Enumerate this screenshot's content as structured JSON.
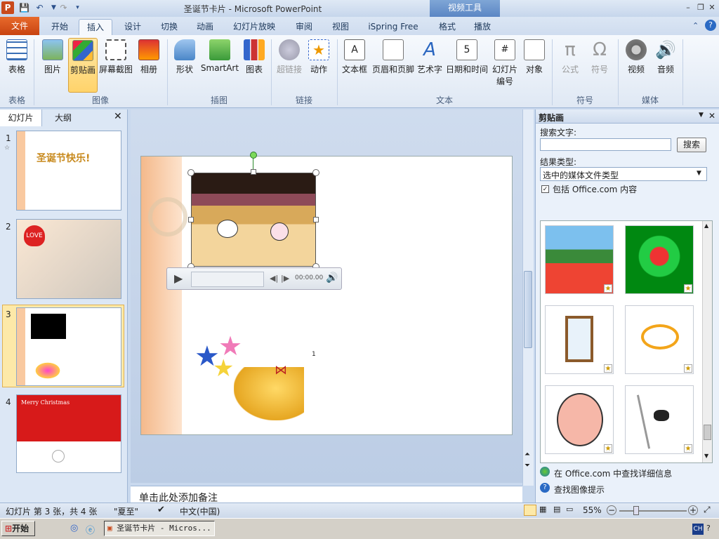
{
  "title": "圣诞节卡片 - Microsoft PowerPoint",
  "contextual_tab": "视频工具",
  "tabs": {
    "file": "文件",
    "items": [
      {
        "label": "开始"
      },
      {
        "label": "插入"
      },
      {
        "label": "设计"
      },
      {
        "label": "切换"
      },
      {
        "label": "动画"
      },
      {
        "label": "幻灯片放映"
      },
      {
        "label": "审阅"
      },
      {
        "label": "视图"
      },
      {
        "label": "iSpring Free"
      },
      {
        "label": "格式"
      },
      {
        "label": "播放"
      }
    ],
    "active": "插入"
  },
  "ribbon": {
    "buttons": [
      {
        "label": "表格"
      },
      {
        "label": "图片"
      },
      {
        "label": "剪贴画"
      },
      {
        "label": "屏幕截图"
      },
      {
        "label": "相册"
      },
      {
        "label": "形状"
      },
      {
        "label": "SmartArt"
      },
      {
        "label": "图表"
      },
      {
        "label": "超链接"
      },
      {
        "label": "动作"
      },
      {
        "label": "文本框"
      },
      {
        "label": "页眉和页脚"
      },
      {
        "label": "艺术字"
      },
      {
        "label": "日期和时间"
      },
      {
        "label": "幻灯片"
      },
      {
        "label": "编号"
      },
      {
        "label": "对象"
      },
      {
        "label": "公式"
      },
      {
        "label": "符号"
      },
      {
        "label": "视频"
      },
      {
        "label": "音频"
      }
    ],
    "groups": [
      {
        "label": "表格"
      },
      {
        "label": "图像"
      },
      {
        "label": "插图"
      },
      {
        "label": "链接"
      },
      {
        "label": "文本"
      },
      {
        "label": "符号"
      },
      {
        "label": "媒体"
      }
    ]
  },
  "left_pane": {
    "tabs": [
      "幻灯片",
      "大纲"
    ],
    "slides": [
      {
        "num": "1",
        "text": "圣诞节快乐!"
      },
      {
        "num": "2",
        "text": "LOVE"
      },
      {
        "num": "3",
        "text": ""
      },
      {
        "num": "4",
        "text": "Merry Christmas"
      }
    ]
  },
  "video": {
    "time": "00:00.00"
  },
  "slide_page_marker": "1",
  "notes_placeholder": "单击此处添加备注",
  "clipart": {
    "title": "剪贴画",
    "search_label": "搜索文字:",
    "search_value": "",
    "search_button": "搜索",
    "result_type_label": "结果类型:",
    "result_type_value": "选中的媒体文件类型",
    "include_office": "包括 Office.com 内容",
    "include_checked": true,
    "items": [
      {
        "icon": "tulips-windmill-clip"
      },
      {
        "icon": "red-flowers-clip"
      },
      {
        "icon": "window-clip"
      },
      {
        "icon": "tiger-hoop-clip"
      },
      {
        "icon": "old-man-face-clip"
      },
      {
        "icon": "bird-pole-clip"
      }
    ],
    "link_more": "在 Office.com 中查找详细信息",
    "link_tips": "查找图像提示"
  },
  "status": {
    "slide_info": "幻灯片 第 3 张，共 4 张",
    "theme": "\"夏至\"",
    "language": "中文(中国)",
    "zoom": "55%"
  },
  "taskbar": {
    "start": "开始",
    "window": "圣诞节卡片 - Micros...",
    "ime": "CH"
  },
  "colors": {
    "accent": "#c84411",
    "ribbon_select": "#ffd36b"
  }
}
